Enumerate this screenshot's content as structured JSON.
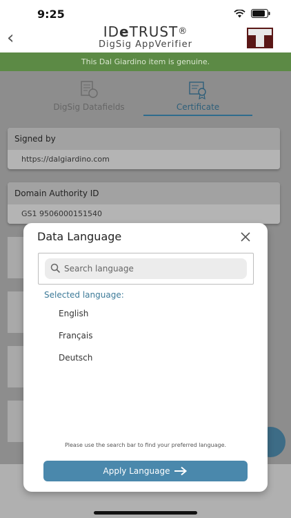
{
  "status_bar": {
    "time": "9:25"
  },
  "header": {
    "brand_prefix": "ID",
    "brand_e": "e",
    "brand_suffix": "TRUST",
    "brand_reg": "®",
    "brand_subtitle": "DigSig AppVerifier"
  },
  "banner": {
    "text": "This Dal Giardino item is genuine."
  },
  "tabs": [
    {
      "label": "DigSig Datafields",
      "icon": "document-seal-icon"
    },
    {
      "label": "Certificate",
      "icon": "certificate-icon",
      "active": true
    }
  ],
  "cards": [
    {
      "title": "Signed by",
      "value": "https://dalgiardino.com"
    },
    {
      "title": "Domain Authority ID",
      "value": "GS1 9506000151540"
    }
  ],
  "modal": {
    "title": "Data Language",
    "search_placeholder": "Search language",
    "selected_label": "Selected language:",
    "languages": [
      "English",
      "Français",
      "Deutsch"
    ],
    "hint": "Please use the search bar to find your preferred language.",
    "apply_label": "Apply Language"
  },
  "colors": {
    "banner": "#5c8a45",
    "accent": "#4a88ac",
    "selected_label": "#3c7a98",
    "overlay_gray": "#8d8d8d"
  }
}
